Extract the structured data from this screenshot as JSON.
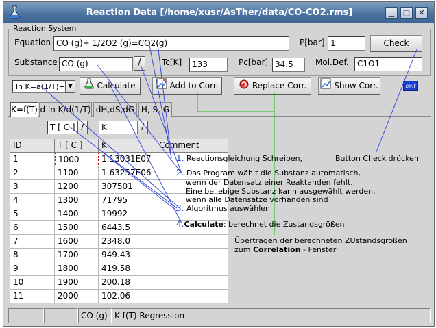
{
  "window": {
    "title": "Reaction Data [/home/xusr/AsTher/data/CO-CO2.rms]"
  },
  "reaction_system": {
    "group_label": "Reaction System",
    "equation_label": "Equation",
    "equation_value": "CO (g)+ 1/2O2 (g)=CO2(g)",
    "pbar_label": "P[bar]",
    "pbar_value": "1",
    "check_button": "Check",
    "substance_label": "Substance",
    "substance_value": "CO (g)",
    "slash": "/",
    "tc_label": "Tc[K]",
    "tc_value": "133",
    "pc_label": "Pc[bar]",
    "pc_value": "34.5",
    "moldef_label": "Mol.Def.",
    "moldef_value": "C1O1"
  },
  "toolbar": {
    "algorithm_value": "ln K=a(1/T)+b",
    "calculate_label": "Calculate",
    "add_label": "Add to Corr.",
    "replace_label": "Replace Corr.",
    "show_label": "Show Corr.",
    "exit_label": "exit"
  },
  "tabs": [
    {
      "label": "K=f(T)"
    },
    {
      "label": "d ln K/d(1/T)"
    },
    {
      "label": "dH,dS,dG"
    },
    {
      "label": "H, S, G"
    }
  ],
  "axis_selector": {
    "x_value": "T [ C ]",
    "y_value": "K",
    "slash": "/"
  },
  "table": {
    "columns": [
      "ID",
      "T [ C ]",
      "K",
      "Comment"
    ],
    "rows": [
      [
        "1",
        "1000",
        "1.13031E07",
        ""
      ],
      [
        "2",
        "1100",
        "1.63257E06",
        ""
      ],
      [
        "3",
        "1200",
        "307501",
        ""
      ],
      [
        "4",
        "1300",
        "71795",
        ""
      ],
      [
        "5",
        "1400",
        "19992",
        ""
      ],
      [
        "6",
        "1500",
        "6443.5",
        ""
      ],
      [
        "7",
        "1600",
        "2348.0",
        ""
      ],
      [
        "8",
        "1700",
        "949.43",
        ""
      ],
      [
        "9",
        "1800",
        "419.58",
        ""
      ],
      [
        "10",
        "1900",
        "200.18",
        ""
      ],
      [
        "11",
        "2000",
        "102.06",
        ""
      ]
    ]
  },
  "annotations": {
    "n1": "1.",
    "a1": "Reactionsgleichung Schreiben,",
    "a1b": "Button  Check  drücken",
    "n2": "2.",
    "a2_l1": "Das Program wählt die Substanz automatisch,",
    "a2_l2": "wenn der Datensatz einer Reaktanden fehlt.",
    "a2_l3": "Eine beliebige Substanz kann ausgewählt werden,",
    "a2_l4": "wenn alle Datensätze vorhanden sind",
    "n3": "3.",
    "a3": "Algoritmus auswählen",
    "n4": "4.",
    "a4_bold": "Calculate",
    "a4_rest": ": berechnet die Zustandsgrößen",
    "a5_l1": "Übertragen der berechneten ZUstandsgrößen",
    "a5_pre": "zum ",
    "a5_bold": "Correlation",
    "a5_post": " - Fenster"
  },
  "statusbar": {
    "cell1": "",
    "cell2": "",
    "substance": "CO (g)",
    "mode": "K f(T) Regression"
  },
  "colors": {
    "title_bar": "#4c74a1",
    "annotation_number": "#2244cc",
    "line_blue": "#3a4fd6",
    "line_green": "#18c018"
  }
}
